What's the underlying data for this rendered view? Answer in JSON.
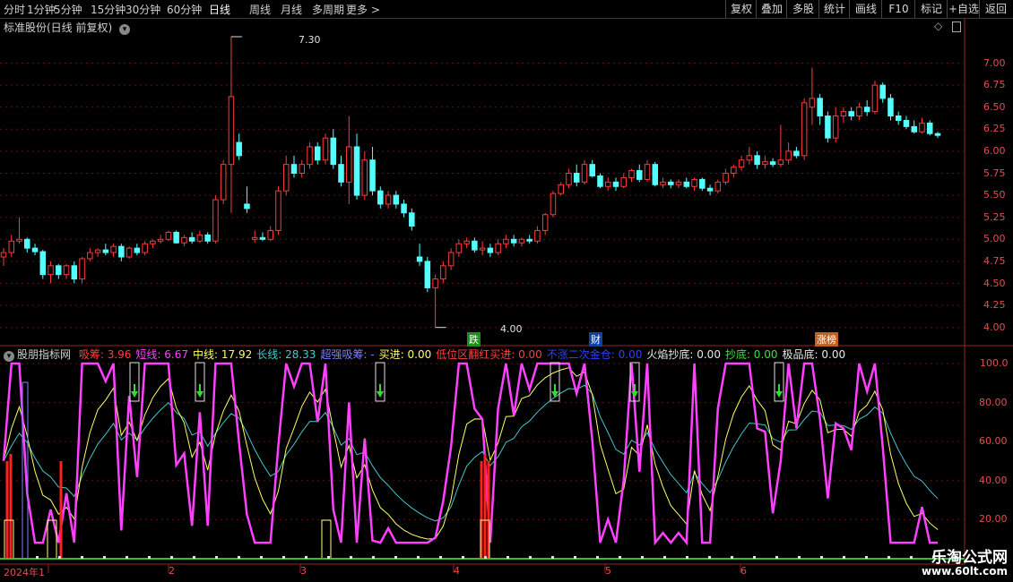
{
  "toolbar": {
    "timeframes": [
      "分时",
      "1分钟",
      "5分钟",
      "15分钟",
      "30分钟",
      "60分钟",
      "日线",
      "周线",
      "月线",
      "多周期",
      "更多 >"
    ],
    "active_timeframe": "日线",
    "right_buttons": [
      "复权",
      "叠加",
      "多股",
      "统计",
      "画线",
      "F10",
      "标记",
      "+自选",
      "返回"
    ]
  },
  "main_panel": {
    "title": "标准股份(日线 前复权)",
    "price_axis": [
      "7.00",
      "6.75",
      "6.50",
      "6.25",
      "6.00",
      "5.75",
      "5.50",
      "5.25",
      "5.00",
      "4.75",
      "4.50",
      "4.25",
      "4.00"
    ],
    "high_label": "7.30",
    "low_label": "4.00",
    "event_tags": [
      "跌",
      "财",
      "涨榜"
    ]
  },
  "indicator_panel": {
    "title": "股朋指标网",
    "readouts": [
      {
        "name": "吸筹:",
        "value": "3.96",
        "color": "#ff4040"
      },
      {
        "name": "短线:",
        "value": "6.67",
        "color": "#ff40ff"
      },
      {
        "name": "中线:",
        "value": "17.92",
        "color": "#ffff60"
      },
      {
        "name": "长线:",
        "value": "28.33",
        "color": "#40d0d0"
      },
      {
        "name": "超强吸筹:",
        "value": "-",
        "color": "#8080ff"
      },
      {
        "name": "买进:",
        "value": "0.00",
        "color": "#ffff60"
      },
      {
        "name": "低位区翻红买进:",
        "value": "0.00",
        "color": "#ff4040"
      },
      {
        "name": "不涨二次金仓:",
        "value": "0.00",
        "color": "#3040ff"
      },
      {
        "name": "火焰抄底:",
        "value": "0.00",
        "color": "#e8e8e8"
      },
      {
        "name": "抄底:",
        "value": "0.00",
        "color": "#40e040"
      },
      {
        "name": "极品底:",
        "value": "0.00",
        "color": "#e8e8e8"
      }
    ],
    "axis": [
      "100.0",
      "80.00",
      "60.00",
      "40.00",
      "20.00"
    ]
  },
  "x_axis": [
    "2024年1",
    "2",
    "3",
    "4",
    "5",
    "6"
  ],
  "watermark": {
    "title": "乐淘公式网",
    "url": "www.60lt.com"
  },
  "chart_data": {
    "type": "candlestick",
    "title": "标准股份(日线 前复权)",
    "ylim": [
      3.9,
      7.35
    ],
    "candles": [
      [
        4.8,
        4.9,
        4.7,
        4.85
      ],
      [
        4.85,
        5.05,
        4.8,
        4.98
      ],
      [
        4.98,
        5.25,
        4.95,
        5.0
      ],
      [
        5.0,
        5.02,
        4.85,
        4.9
      ],
      [
        4.9,
        4.95,
        4.82,
        4.86
      ],
      [
        4.86,
        4.88,
        4.55,
        4.6
      ],
      [
        4.6,
        4.75,
        4.5,
        4.7
      ],
      [
        4.7,
        4.72,
        4.55,
        4.6
      ],
      [
        4.6,
        4.72,
        4.55,
        4.7
      ],
      [
        4.7,
        4.75,
        4.5,
        4.55
      ],
      [
        4.55,
        4.8,
        4.5,
        4.78
      ],
      [
        4.78,
        4.9,
        4.75,
        4.85
      ],
      [
        4.85,
        4.9,
        4.8,
        4.88
      ],
      [
        4.88,
        4.95,
        4.82,
        4.85
      ],
      [
        4.85,
        4.95,
        4.8,
        4.92
      ],
      [
        4.92,
        4.95,
        4.75,
        4.8
      ],
      [
        4.8,
        4.92,
        4.78,
        4.9
      ],
      [
        4.9,
        4.95,
        4.82,
        4.85
      ],
      [
        4.85,
        4.98,
        4.82,
        4.95
      ],
      [
        4.95,
        5.0,
        4.9,
        4.98
      ],
      [
        4.98,
        5.05,
        4.95,
        5.0
      ],
      [
        5.0,
        5.1,
        4.98,
        5.08
      ],
      [
        5.08,
        5.1,
        4.95,
        4.96
      ],
      [
        4.96,
        5.05,
        4.92,
        5.02
      ],
      [
        5.02,
        5.08,
        4.95,
        4.98
      ],
      [
        4.98,
        5.1,
        4.96,
        5.05
      ],
      [
        5.05,
        5.08,
        4.95,
        4.98
      ],
      [
        4.98,
        5.5,
        4.95,
        5.45
      ],
      [
        5.45,
        5.9,
        5.4,
        5.85
      ],
      [
        5.85,
        7.3,
        5.3,
        6.62
      ],
      [
        6.1,
        6.2,
        5.9,
        5.95
      ],
      [
        5.4,
        5.6,
        5.3,
        5.35
      ],
      [
        5.0,
        5.1,
        4.96,
        5.02
      ],
      [
        5.02,
        5.08,
        4.98,
        5.0
      ],
      [
        5.0,
        5.15,
        4.98,
        5.1
      ],
      [
        5.1,
        5.6,
        5.05,
        5.55
      ],
      [
        5.55,
        5.95,
        5.5,
        5.85
      ],
      [
        5.85,
        5.95,
        5.7,
        5.75
      ],
      [
        5.75,
        5.9,
        5.7,
        5.85
      ],
      [
        5.85,
        6.1,
        5.8,
        6.05
      ],
      [
        6.05,
        6.1,
        5.85,
        5.9
      ],
      [
        5.9,
        6.2,
        5.85,
        6.15
      ],
      [
        6.15,
        6.25,
        5.8,
        5.85
      ],
      [
        5.85,
        5.95,
        5.6,
        5.65
      ],
      [
        5.65,
        6.4,
        5.4,
        6.05
      ],
      [
        6.05,
        6.2,
        5.45,
        5.5
      ],
      [
        5.5,
        6.0,
        5.45,
        5.9
      ],
      [
        5.9,
        6.05,
        5.5,
        5.55
      ],
      [
        5.55,
        5.6,
        5.35,
        5.4
      ],
      [
        5.4,
        5.55,
        5.35,
        5.5
      ],
      [
        5.5,
        5.55,
        5.35,
        5.4
      ],
      [
        5.4,
        5.45,
        5.25,
        5.3
      ],
      [
        5.3,
        5.35,
        5.1,
        5.15
      ],
      [
        4.8,
        4.95,
        4.7,
        4.75
      ],
      [
        4.75,
        4.8,
        4.4,
        4.45
      ],
      [
        4.45,
        4.6,
        4.0,
        4.55
      ],
      [
        4.55,
        4.75,
        4.5,
        4.7
      ],
      [
        4.7,
        4.9,
        4.65,
        4.85
      ],
      [
        4.85,
        5.0,
        4.8,
        4.95
      ],
      [
        4.95,
        5.02,
        4.9,
        4.98
      ],
      [
        4.98,
        5.02,
        4.85,
        4.88
      ],
      [
        4.88,
        4.98,
        4.82,
        4.9
      ],
      [
        4.9,
        4.95,
        4.8,
        4.85
      ],
      [
        4.85,
        5.0,
        4.82,
        4.95
      ],
      [
        4.95,
        5.05,
        4.9,
        5.0
      ],
      [
        5.0,
        5.05,
        4.92,
        4.96
      ],
      [
        4.96,
        5.02,
        4.92,
        5.0
      ],
      [
        5.0,
        5.05,
        4.95,
        4.98
      ],
      [
        4.98,
        5.15,
        4.95,
        5.1
      ],
      [
        5.1,
        5.3,
        5.05,
        5.28
      ],
      [
        5.28,
        5.55,
        5.25,
        5.52
      ],
      [
        5.52,
        5.65,
        5.5,
        5.62
      ],
      [
        5.62,
        5.8,
        5.58,
        5.75
      ],
      [
        5.75,
        5.85,
        5.6,
        5.65
      ],
      [
        5.65,
        5.9,
        5.62,
        5.85
      ],
      [
        5.85,
        5.9,
        5.7,
        5.72
      ],
      [
        5.72,
        5.75,
        5.58,
        5.6
      ],
      [
        5.6,
        5.7,
        5.55,
        5.65
      ],
      [
        5.65,
        5.7,
        5.55,
        5.6
      ],
      [
        5.6,
        5.75,
        5.58,
        5.7
      ],
      [
        5.7,
        5.8,
        5.65,
        5.78
      ],
      [
        5.78,
        5.85,
        5.65,
        5.68
      ],
      [
        5.68,
        5.9,
        5.65,
        5.85
      ],
      [
        5.85,
        5.88,
        5.6,
        5.62
      ],
      [
        5.62,
        5.7,
        5.58,
        5.65
      ],
      [
        5.65,
        5.68,
        5.58,
        5.62
      ],
      [
        5.62,
        5.68,
        5.58,
        5.65
      ],
      [
        5.65,
        5.7,
        5.58,
        5.6
      ],
      [
        5.6,
        5.7,
        5.55,
        5.68
      ],
      [
        5.68,
        5.7,
        5.55,
        5.58
      ],
      [
        5.58,
        5.62,
        5.5,
        5.55
      ],
      [
        5.55,
        5.68,
        5.52,
        5.65
      ],
      [
        5.65,
        5.8,
        5.62,
        5.75
      ],
      [
        5.75,
        5.85,
        5.7,
        5.82
      ],
      [
        5.82,
        5.95,
        5.78,
        5.9
      ],
      [
        5.9,
        6.05,
        5.85,
        5.95
      ],
      [
        5.95,
        6.0,
        5.8,
        5.85
      ],
      [
        5.85,
        5.95,
        5.8,
        5.88
      ],
      [
        5.88,
        5.92,
        5.82,
        5.85
      ],
      [
        5.85,
        6.3,
        5.82,
        5.9
      ],
      [
        5.9,
        6.1,
        5.85,
        6.0
      ],
      [
        6.0,
        6.05,
        5.92,
        5.95
      ],
      [
        5.95,
        6.6,
        5.9,
        6.55
      ],
      [
        6.5,
        6.95,
        6.3,
        6.6
      ],
      [
        6.6,
        6.65,
        6.3,
        6.4
      ],
      [
        6.4,
        6.45,
        6.1,
        6.15
      ],
      [
        6.15,
        6.5,
        6.1,
        6.4
      ],
      [
        6.4,
        6.5,
        6.32,
        6.45
      ],
      [
        6.45,
        6.5,
        6.35,
        6.4
      ],
      [
        6.4,
        6.55,
        6.35,
        6.5
      ],
      [
        6.5,
        6.58,
        6.4,
        6.45
      ],
      [
        6.45,
        6.8,
        6.42,
        6.75
      ],
      [
        6.75,
        6.78,
        6.55,
        6.6
      ],
      [
        6.6,
        6.65,
        6.35,
        6.4
      ],
      [
        6.4,
        6.45,
        6.3,
        6.35
      ],
      [
        6.35,
        6.4,
        6.25,
        6.28
      ],
      [
        6.28,
        6.35,
        6.2,
        6.22
      ],
      [
        6.22,
        6.38,
        6.2,
        6.32
      ],
      [
        6.32,
        6.35,
        6.18,
        6.2
      ],
      [
        6.2,
        6.22,
        6.15,
        6.18
      ]
    ]
  }
}
